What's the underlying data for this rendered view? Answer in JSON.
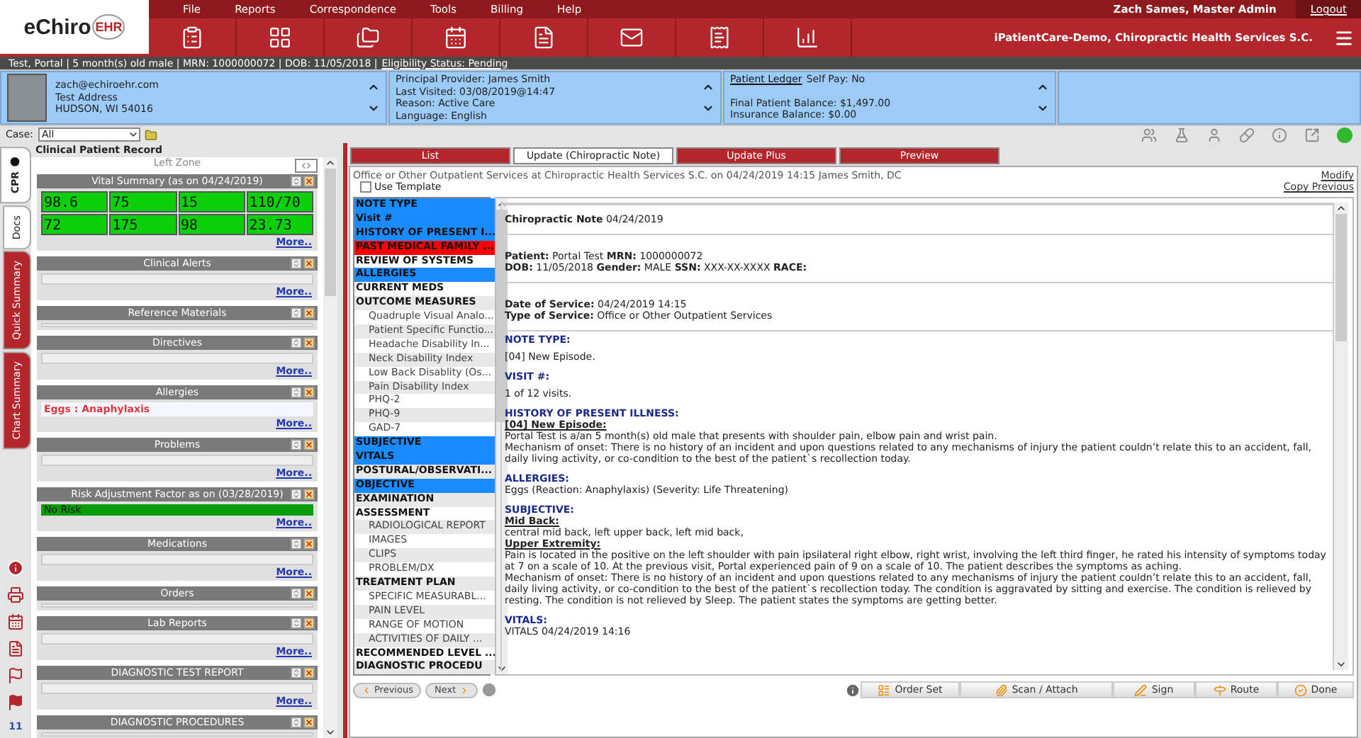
{
  "header": {
    "logo": {
      "text": "eChiro",
      "badge": "EHR"
    },
    "menu": [
      "File",
      "Reports",
      "Correspondence",
      "Tools",
      "Billing",
      "Help"
    ],
    "user": "Zach Sames, Master Admin",
    "logout": "Logout",
    "organization": "iPatientCare-Demo, Chiropractic Health Services S.C."
  },
  "patient_bar": {
    "summary": "Test, Portal | 5 month(s) old male | MRN: 1000000072 | DOB: 11/05/2018 |",
    "eligibility": "Eligibility Status: Pending"
  },
  "info_cards": [
    {
      "kind": "contact",
      "lines": [
        "zach@echiroehr.com",
        "Test Address",
        "HUDSON, WI 54016"
      ]
    },
    {
      "kind": "plain",
      "lines": [
        "Principal Provider: James Smith",
        "Last Visited: 03/08/2019@14:47",
        "Reason: Active Care",
        "Language: English"
      ]
    },
    {
      "kind": "ledger",
      "link": "Patient Ledger",
      "lines": [
        "Self Pay: No",
        "Final Patient Balance: $1,497.00",
        "Insurance Balance: $0.00"
      ]
    },
    {
      "kind": "empty"
    }
  ],
  "case": {
    "label": "Case:",
    "value": "All"
  },
  "side_tabs": [
    {
      "label": "CPR",
      "selected": true,
      "color": "#ffffff"
    },
    {
      "label": "Docs",
      "selected": false,
      "color": "#ffffff"
    },
    {
      "label": "Quick Summary",
      "selected": false,
      "color": "#b3262b"
    },
    {
      "label": "Chart Summary",
      "selected": false,
      "color": "#b3262b"
    }
  ],
  "flag_count": "11",
  "left_panel": {
    "title": "Clinical Patient Record",
    "zone": "Left Zone",
    "widgets": [
      {
        "title": "Vital Summary (as on 04/24/2019)",
        "kind": "vitals",
        "rows": [
          [
            "98.6",
            "75",
            "15",
            "110/70"
          ],
          [
            "72",
            "175",
            "98",
            "23.73"
          ]
        ],
        "more": "More.."
      },
      {
        "title": "Clinical Alerts",
        "kind": "blank",
        "more": "More.."
      },
      {
        "title": "Reference Materials",
        "kind": "thin"
      },
      {
        "title": "Directives",
        "kind": "blank",
        "more": "More.."
      },
      {
        "title": "Allergies",
        "kind": "alert",
        "text": "Eggs : Anaphylaxis",
        "more": "More.."
      },
      {
        "title": "Problems",
        "kind": "blank",
        "more": "More.."
      },
      {
        "title": "Risk Adjustment Factor as on (03/28/2019)",
        "kind": "risk",
        "text": "No Risk",
        "more": "More.."
      },
      {
        "title": "Medications",
        "kind": "blank",
        "more": "More.."
      },
      {
        "title": "Orders",
        "kind": "thin"
      },
      {
        "title": "Lab Reports",
        "kind": "blank",
        "more": "More.."
      },
      {
        "title": "DIAGNOSTIC TEST REPORT",
        "kind": "blank",
        "more": "More.."
      },
      {
        "title": "DIAGNOSTIC PROCEDURES",
        "kind": "thin"
      }
    ]
  },
  "tabs": [
    {
      "label": "List",
      "selected": false
    },
    {
      "label": "Update (Chiropractic Note)",
      "selected": true
    },
    {
      "label": "Update Plus",
      "selected": false
    },
    {
      "label": "Preview",
      "selected": false
    }
  ],
  "encounter": "Office or Other Outpatient Services at Chiropractic Health Services S.C. on 04/24/2019 14:15 James Smith, DC",
  "links": [
    "Modify",
    "Copy Previous"
  ],
  "use_template": {
    "label": "Use Template",
    "checked": false
  },
  "nav_items": [
    {
      "label": "NOTE TYPE",
      "color": "#1a8cff"
    },
    {
      "label": "Visit #",
      "color": "#1a8cff"
    },
    {
      "label": "HISTORY OF PRESENT I...",
      "color": "#1a8cff"
    },
    {
      "label": "PAST MEDICAL FAMILY ...",
      "color": "#ff0000"
    },
    {
      "label": "REVIEW OF SYSTEMS"
    },
    {
      "label": "ALLERGIES",
      "color": "#1a8cff"
    },
    {
      "label": "CURRENT MEDS"
    },
    {
      "label": "OUTCOME MEASURES",
      "children": [
        {
          "label": "Quadruple Visual Analo..."
        },
        {
          "label": "Patient Specific Functio..."
        },
        {
          "label": "Headache Disability In..."
        },
        {
          "label": "Neck Disability Index"
        },
        {
          "label": "Low Back Disablity (Os..."
        },
        {
          "label": "Pain Disability Index"
        },
        {
          "label": "PHQ-2"
        },
        {
          "label": "PHQ-9"
        },
        {
          "label": "GAD-7"
        }
      ]
    },
    {
      "label": "SUBJECTIVE",
      "color": "#1a8cff"
    },
    {
      "label": "VITALS",
      "color": "#1a8cff"
    },
    {
      "label": "POSTURAL/OBSERVATI..."
    },
    {
      "label": "OBJECTIVE",
      "color": "#1a8cff"
    },
    {
      "label": "EXAMINATION"
    },
    {
      "label": "ASSESSMENT",
      "children": [
        {
          "label": "RADIOLOGICAL REPORT"
        },
        {
          "label": "IMAGES"
        },
        {
          "label": "CLIPS"
        },
        {
          "label": "PROBLEM/DX"
        }
      ]
    },
    {
      "label": "TREATMENT PLAN",
      "children": [
        {
          "label": "SPECIFIC MEASURABL..."
        },
        {
          "label": "PAIN LEVEL"
        },
        {
          "label": "RANGE OF MOTION"
        },
        {
          "label": "ACTIVITIES OF DAILY ..."
        }
      ]
    },
    {
      "label": "RECOMMENDED LEVEL ..."
    },
    {
      "label": "DIAGNOSTIC PROCEDU"
    }
  ],
  "note": {
    "header_groups": [
      [
        "**Chiropractic Note** 04/24/2019"
      ],
      [
        "**Patient:** Portal Test **MRN:** 1000000072",
        "**DOB:** 11/05/2018 **Gender:** MALE **SSN:** XXX-XX-XXXX **RACE:**"
      ],
      [
        "**Date of Service:** 04/24/2019 14:15",
        "**Type of Service:** Office or Other Outpatient Services"
      ]
    ],
    "sections": [
      {
        "title": "NOTE TYPE:",
        "lines": [
          {
            "kind": "text",
            "text": "[04] New Episode."
          }
        ]
      },
      {
        "title": "VISIT #:",
        "lines": [
          {
            "kind": "text",
            "text": "1  of 12 visits."
          }
        ]
      },
      {
        "title": "HISTORY OF PRESENT ILLNESS:",
        "lines": [
          {
            "kind": "subhead",
            "text": "[04] New Episode:"
          },
          {
            "kind": "text",
            "text": "Portal Test is a/an 5 month(s)  old male that presents with shoulder pain, elbow pain and wrist pain."
          },
          {
            "kind": "text",
            "text": "Mechanism of onset: There is no history of an incident and upon questions related to any mechanisms of injury the patient couldn’t relate this to an accident, fall, daily living activity, or co-condition to the best of the patient`s recollection today."
          }
        ]
      },
      {
        "title": "ALLERGIES:",
        "lines": [
          {
            "kind": "text",
            "text": "Eggs (Reaction: Anaphylaxis) (Severity: Life Threatening)"
          }
        ]
      },
      {
        "title": "SUBJECTIVE:",
        "lines": [
          {
            "kind": "subhead",
            "text": "Mid Back:"
          },
          {
            "kind": "text",
            "text": "central mid back, left upper back, left mid back,"
          },
          {
            "kind": "subhead",
            "text": "Upper Extremity:"
          },
          {
            "kind": "text",
            "text": "Pain is located in the positive on the left shoulder with pain ipsilateral right elbow, right wrist, involving the left third finger, he rated his intensity of symptoms today at 7 on a scale of 10. At the previous visit, Portal experienced pain of 9 on a scale of 10. The patient describes the symptoms as aching."
          },
          {
            "kind": "text",
            "text": "Mechanism of onset: There is no history of an incident and upon questions related to any mechanisms of injury the patient couldn’t relate this to an accident, fall, daily living activity, or co-condition to the best of the patient`s recollection today. The condition is aggravated by sitting and exercise. The condition is relieved by resting. The condition is not relieved by Sleep. The patient states the symptoms are getting better."
          }
        ]
      },
      {
        "title": "VITALS:",
        "lines": [
          {
            "kind": "text",
            "text": "VITALS 04/24/2019 14:16"
          }
        ]
      }
    ]
  },
  "pager": [
    "Previous",
    "Next"
  ],
  "actions": [
    "Order Set",
    "Scan / Attach",
    "Sign",
    "Route",
    "Done"
  ]
}
